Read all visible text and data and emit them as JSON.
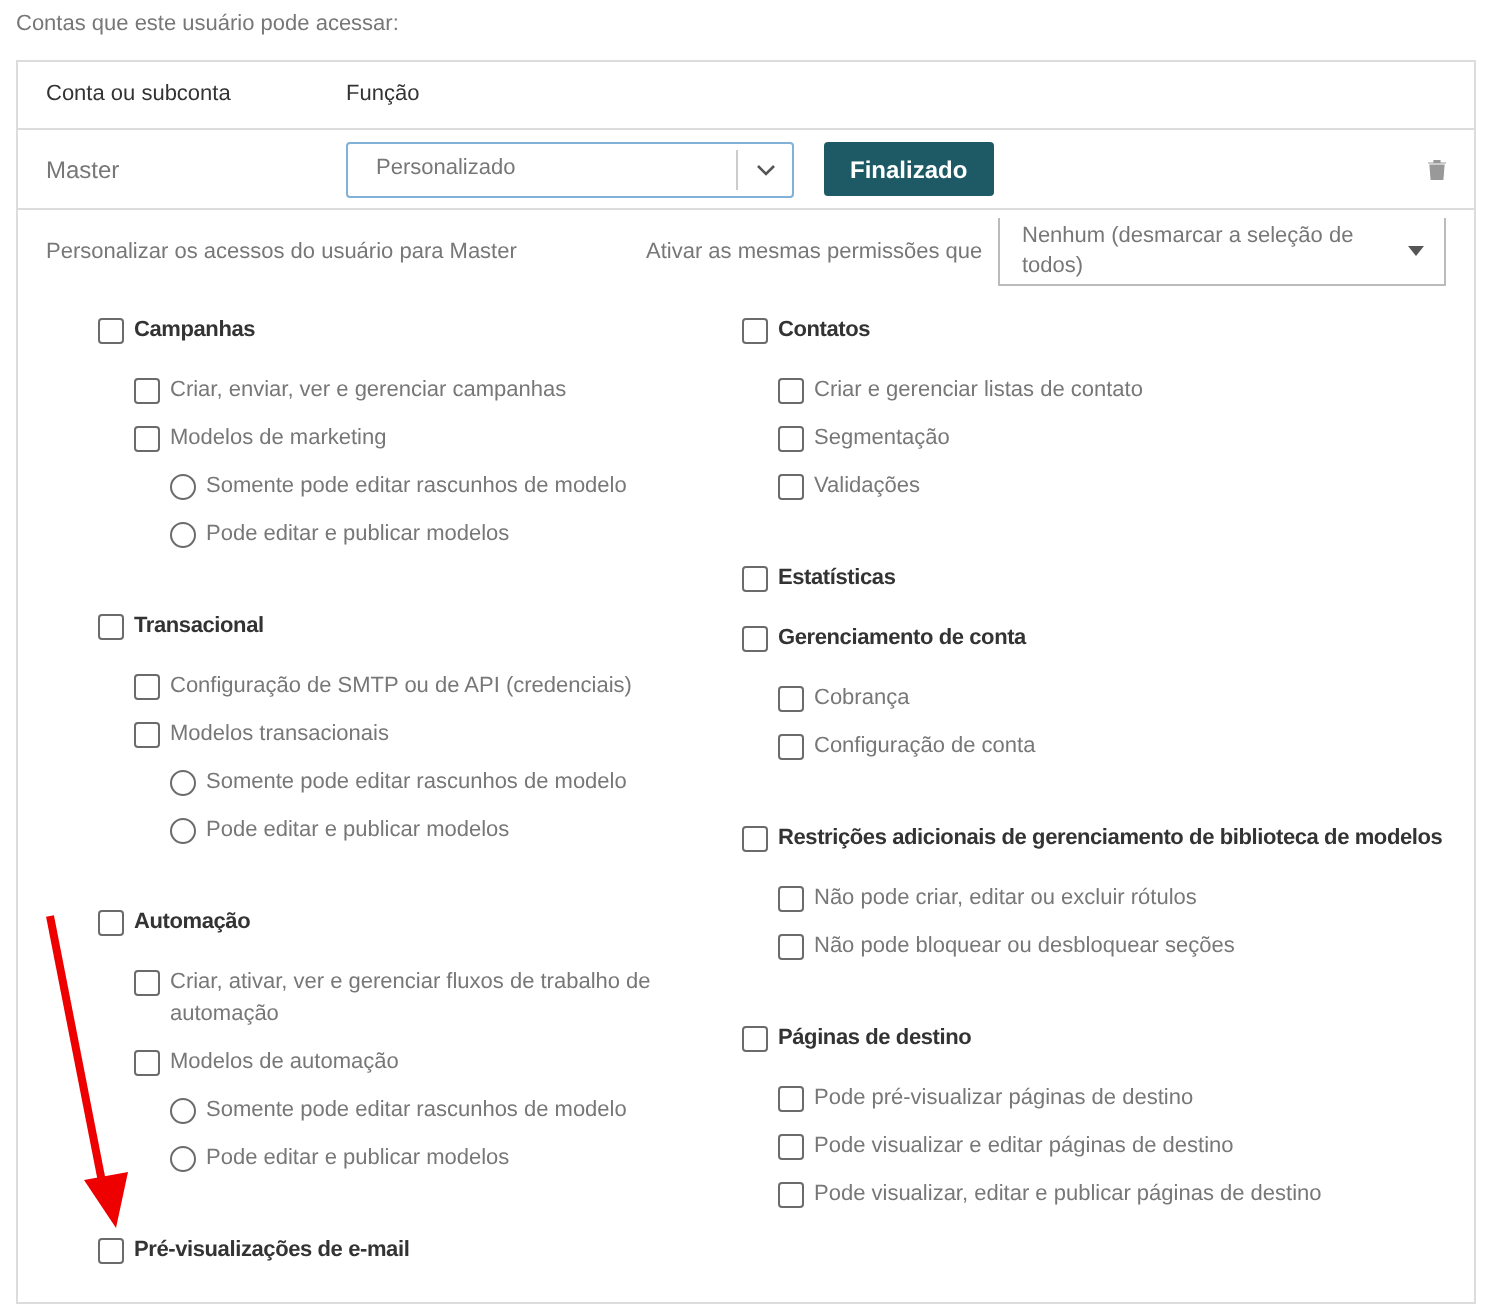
{
  "intro": "Contas que este usuário pode acessar:",
  "table": {
    "columns": [
      "Conta ou subconta",
      "Função"
    ],
    "row": {
      "account": "Master",
      "role": {
        "value": "Personalizado"
      },
      "done_button": "Finalizado"
    }
  },
  "customize": {
    "label": "Personalizar os acessos do usuário para Master",
    "copy_label": "Ativar as mesmas permissões que",
    "copy_select": "Nenhum (desmarcar a seleção de todos)"
  },
  "columns": [
    [
      {
        "label": "Campanhas",
        "checked": false,
        "items": [
          {
            "kind": "checkbox",
            "label": "Criar, enviar, ver e gerenciar campanhas",
            "checked": false
          },
          {
            "kind": "checkbox",
            "label": "Modelos de marketing",
            "checked": false
          },
          {
            "kind": "radio",
            "label": "Somente pode editar rascunhos de modelo",
            "selected": false
          },
          {
            "kind": "radio",
            "label": "Pode editar e publicar modelos",
            "selected": false
          }
        ]
      },
      {
        "label": "Transacional",
        "checked": false,
        "items": [
          {
            "kind": "checkbox",
            "label": "Configuração de SMTP ou de API (credenciais)",
            "checked": false
          },
          {
            "kind": "checkbox",
            "label": "Modelos transacionais",
            "checked": false
          },
          {
            "kind": "radio",
            "label": "Somente pode editar rascunhos de modelo",
            "selected": false
          },
          {
            "kind": "radio",
            "label": "Pode editar e publicar modelos",
            "selected": false
          }
        ]
      },
      {
        "label": "Automação",
        "checked": false,
        "items": [
          {
            "kind": "checkbox",
            "label": "Criar, ativar, ver e gerenciar fluxos de trabalho de automação",
            "checked": false
          },
          {
            "kind": "checkbox",
            "label": "Modelos de automação",
            "checked": false
          },
          {
            "kind": "radio",
            "label": "Somente pode editar rascunhos de modelo",
            "selected": false
          },
          {
            "kind": "radio",
            "label": "Pode editar e publicar modelos",
            "selected": false
          }
        ]
      },
      {
        "label": "Pré-visualizações de e-mail",
        "checked": false
      }
    ],
    [
      {
        "label": "Contatos",
        "checked": false,
        "items": [
          {
            "kind": "checkbox",
            "label": "Criar e gerenciar listas de contato",
            "checked": false
          },
          {
            "kind": "checkbox",
            "label": "Segmentação",
            "checked": false
          },
          {
            "kind": "checkbox",
            "label": "Validações",
            "checked": false
          }
        ]
      },
      {
        "label": "Estatísticas",
        "checked": false
      },
      {
        "label": "Gerenciamento de conta",
        "checked": false,
        "items": [
          {
            "kind": "checkbox",
            "label": "Cobrança",
            "checked": false
          },
          {
            "kind": "checkbox",
            "label": "Configuração de conta",
            "checked": false
          }
        ]
      },
      {
        "label": "Restrições adicionais de gerenciamento de biblioteca de modelos",
        "checked": false,
        "items": [
          {
            "kind": "checkbox",
            "label": "Não pode criar, editar ou excluir rótulos",
            "checked": false
          },
          {
            "kind": "checkbox",
            "label": "Não pode bloquear ou desbloquear seções",
            "checked": false
          }
        ]
      },
      {
        "label": "Páginas de destino",
        "checked": false,
        "items": [
          {
            "kind": "checkbox",
            "label": "Pode pré-visualizar páginas de destino",
            "checked": false
          },
          {
            "kind": "checkbox",
            "label": "Pode visualizar e editar páginas de destino",
            "checked": false
          },
          {
            "kind": "checkbox",
            "label": "Pode visualizar, editar e publicar páginas de destino",
            "checked": false
          }
        ]
      }
    ]
  ]
}
